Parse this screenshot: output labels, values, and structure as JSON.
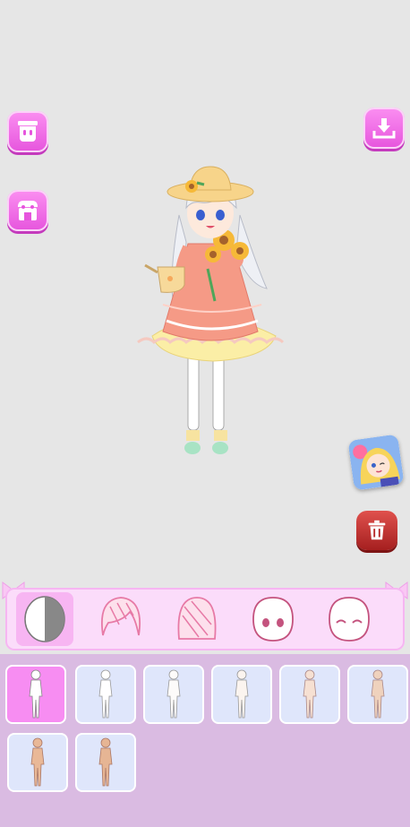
{
  "app": {
    "accent": "#f06be8",
    "danger": "#c52b2b"
  },
  "side_buttons": [
    {
      "icon": "wardrobe-icon"
    },
    {
      "icon": "shop-icon"
    },
    {
      "icon": "download-icon"
    },
    {
      "icon": "delete-icon"
    }
  ],
  "categories": [
    {
      "icon": "skin-tone-icon",
      "active": true
    },
    {
      "icon": "front-hair-icon",
      "active": false
    },
    {
      "icon": "back-hair-icon",
      "active": false
    },
    {
      "icon": "eyes-icon",
      "active": false
    },
    {
      "icon": "expression-icon",
      "active": false
    }
  ],
  "body_items": [
    {
      "skin": "#ffffff",
      "selected": true
    },
    {
      "skin": "#ffffff",
      "selected": false
    },
    {
      "skin": "#fdfbfa",
      "selected": false
    },
    {
      "skin": "#fbf4ef",
      "selected": false
    },
    {
      "skin": "#f6e0d2",
      "selected": false
    },
    {
      "skin": "#efd2bd",
      "selected": false
    },
    {
      "skin": "#e9b897",
      "selected": false
    },
    {
      "skin": "#e6b594",
      "selected": false
    }
  ]
}
